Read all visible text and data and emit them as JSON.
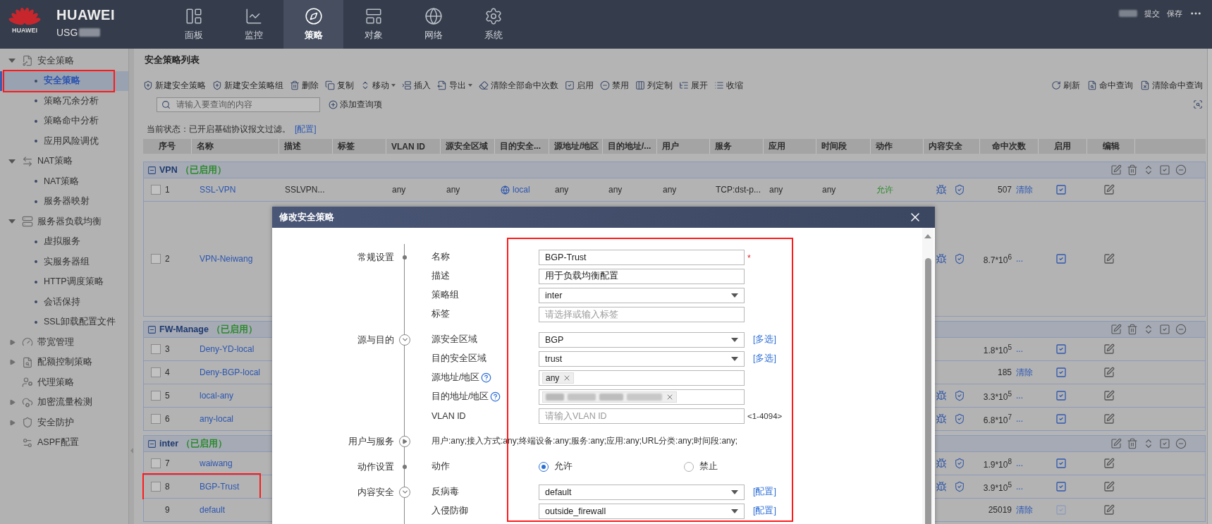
{
  "header": {
    "logo_caption": "HUAWEI",
    "brand": "HUAWEI",
    "device": "USG",
    "nav": [
      {
        "label": "面板",
        "selected": false
      },
      {
        "label": "监控",
        "selected": false
      },
      {
        "label": "策略",
        "selected": true
      },
      {
        "label": "对象",
        "selected": false
      },
      {
        "label": "网络",
        "selected": false
      },
      {
        "label": "系统",
        "selected": false
      }
    ],
    "actions": [
      "提交",
      "保存"
    ]
  },
  "sidebar": {
    "items": [
      {
        "label": "安全策略",
        "kind": "group",
        "expanded": true,
        "children": [
          {
            "label": "安全策略",
            "selected": true,
            "highlighted": true
          },
          {
            "label": "策略冗余分析",
            "selected": false,
            "highlighted": false
          },
          {
            "label": "策略命中分析",
            "selected": false,
            "highlighted": false
          },
          {
            "label": "应用风险调优",
            "selected": false,
            "highlighted": false
          }
        ]
      },
      {
        "label": "NAT策略",
        "kind": "group",
        "expanded": true,
        "children": [
          {
            "label": "NAT策略",
            "selected": false,
            "highlighted": false
          },
          {
            "label": "服务器映射",
            "selected": false,
            "highlighted": false
          }
        ]
      },
      {
        "label": "服务器负载均衡",
        "kind": "group",
        "expanded": true,
        "children": [
          {
            "label": "虚拟服务",
            "selected": false,
            "highlighted": false
          },
          {
            "label": "实服务器组",
            "selected": false,
            "highlighted": false
          },
          {
            "label": "HTTP调度策略",
            "selected": false,
            "highlighted": false
          },
          {
            "label": "会话保持",
            "selected": false,
            "highlighted": false
          },
          {
            "label": "SSL卸载配置文件",
            "selected": false,
            "highlighted": false
          }
        ]
      },
      {
        "label": "带宽管理",
        "kind": "group",
        "expanded": false
      },
      {
        "label": "配额控制策略",
        "kind": "group",
        "expanded": false
      },
      {
        "label": "代理策略",
        "kind": "page"
      },
      {
        "label": "加密流量检测",
        "kind": "group",
        "expanded": false
      },
      {
        "label": "安全防护",
        "kind": "group",
        "expanded": false
      },
      {
        "label": "ASPF配置",
        "kind": "page"
      }
    ]
  },
  "page_title": "安全策略列表",
  "toolbar": {
    "left": [
      {
        "label": "新建安全策略",
        "dropdown": false
      },
      {
        "label": "新建安全策略组",
        "dropdown": false
      },
      {
        "label": "删除",
        "dropdown": false
      },
      {
        "label": "复制",
        "dropdown": false
      },
      {
        "label": "移动",
        "dropdown": true
      },
      {
        "label": "插入",
        "dropdown": false
      },
      {
        "label": "导出",
        "dropdown": true
      },
      {
        "label": "清除全部命中次数",
        "dropdown": false
      },
      {
        "label": "启用",
        "dropdown": false
      },
      {
        "label": "禁用",
        "dropdown": false
      },
      {
        "label": "列定制",
        "dropdown": false
      },
      {
        "label": "展开",
        "dropdown": false
      },
      {
        "label": "收缩",
        "dropdown": false
      }
    ],
    "right": [
      {
        "label": "刷新"
      },
      {
        "label": "命中查询"
      },
      {
        "label": "清除命中查询"
      }
    ]
  },
  "search": {
    "placeholder": "请输入要查询的内容",
    "add_label": "添加查询项"
  },
  "status": {
    "text": "当前状态：已开启基础协议报文过滤。",
    "link": "[配置]"
  },
  "table": {
    "columns": [
      "序号",
      "名称",
      "描述",
      "标签",
      "VLAN ID",
      "源安全区域",
      "目的安全...",
      "源地址/地区",
      "目的地址/...",
      "用户",
      "服务",
      "应用",
      "时间段",
      "动作",
      "内容安全",
      "命中次数",
      "启用",
      "编辑"
    ],
    "groups": [
      {
        "name": "VPN",
        "status": "（已启用）",
        "expanded": true,
        "rows": [
          {
            "no": "1",
            "name": "SSL-VPN",
            "selectable": true,
            "highlighted": false,
            "tall": false,
            "description": "SSLVPN...",
            "vlan_id": "any",
            "source_zone": "any",
            "destination_zone": "local",
            "source_address": "any",
            "destination_address": "any",
            "user": "any",
            "service": "TCP:dst-p...",
            "application": "any",
            "schedule": "any",
            "action": "允许",
            "content_security": true,
            "hits": "507",
            "hits_link": "清除",
            "enabled": true,
            "enable_disabled": false
          },
          {
            "no": "2",
            "name": "VPN-Neiwang",
            "selectable": true,
            "highlighted": false,
            "tall": true,
            "content_security": true,
            "hits": "8.7*10$^{6}$",
            "hits_link": "...",
            "enabled": true,
            "enable_disabled": false
          }
        ]
      },
      {
        "name": "FW-Manage",
        "status": "（已启用）",
        "expanded": true,
        "rows": [
          {
            "no": "3",
            "name": "Deny-YD-local",
            "selectable": true,
            "highlighted": false,
            "tall": false,
            "content_security": false,
            "hits": "1.8*10$^{5}$",
            "hits_link": "...",
            "enabled": true,
            "enable_disabled": false
          },
          {
            "no": "4",
            "name": "Deny-BGP-local",
            "selectable": true,
            "highlighted": false,
            "tall": false,
            "content_security": false,
            "hits": "185",
            "hits_link": "清除",
            "enabled": true,
            "enable_disabled": false
          },
          {
            "no": "5",
            "name": "local-any",
            "selectable": true,
            "highlighted": false,
            "tall": false,
            "content_security": true,
            "hits": "3.3*10$^{5}$",
            "hits_link": "...",
            "enabled": true,
            "enable_disabled": false
          },
          {
            "no": "6",
            "name": "any-local",
            "selectable": true,
            "highlighted": false,
            "tall": false,
            "content_security": true,
            "hits": "6.8*10$^{7}$",
            "hits_link": "...",
            "enabled": true,
            "enable_disabled": false
          }
        ]
      },
      {
        "name": "inter",
        "status": "（已启用）",
        "expanded": true,
        "rows": [
          {
            "no": "7",
            "name": "waiwang",
            "selectable": true,
            "highlighted": false,
            "tall": false,
            "content_security": true,
            "hits": "1.9*10$^{8}$",
            "hits_link": "...",
            "enabled": true,
            "enable_disabled": false
          },
          {
            "no": "8",
            "name": "BGP-Trust",
            "selectable": true,
            "highlighted": true,
            "tall": false,
            "content_security": true,
            "hits": "3.9*10$^{5}$",
            "hits_link": "...",
            "enabled": true,
            "enable_disabled": false
          },
          {
            "no": "9",
            "name": "default",
            "selectable": false,
            "highlighted": false,
            "tall": false,
            "content_security": false,
            "hits": "25019",
            "hits_link": "清除",
            "enabled": true,
            "enable_disabled": true
          }
        ]
      }
    ]
  },
  "dialog": {
    "title": "修改安全策略",
    "highlighted": true,
    "sections": [
      {
        "label": "常规设置",
        "kind": "dot",
        "fields": [
          {
            "label": "名称",
            "kind": "text",
            "value": "BGP-Trust",
            "required_mark": "*"
          },
          {
            "label": "描述",
            "kind": "text",
            "value": "用于负载均衡配置"
          },
          {
            "label": "策略组",
            "kind": "select",
            "value": "inter"
          },
          {
            "label": "标签",
            "kind": "text",
            "placeholder": "请选择或输入标签"
          }
        ]
      },
      {
        "label": "源与目的",
        "kind": "toggle",
        "expanded": true,
        "fields": [
          {
            "label": "源安全区域",
            "kind": "select",
            "value": "BGP",
            "link": "[多选]"
          },
          {
            "label": "目的安全区域",
            "kind": "select",
            "value": "trust",
            "link": "[多选]"
          },
          {
            "label": "源地址/地区",
            "kind": "tags",
            "help": true,
            "tags": [
              {
                "kind": "label",
                "label": "any"
              }
            ]
          },
          {
            "label": "目的地址/地区",
            "kind": "tags",
            "help": true,
            "tags": [
              {
                "kind": "redacted"
              }
            ]
          },
          {
            "label": "VLAN ID",
            "kind": "text",
            "placeholder": "请输入VLAN ID",
            "hint": "<1-4094>"
          }
        ]
      },
      {
        "label": "用户与服务",
        "kind": "toggle",
        "expanded": false,
        "fields": [
          {
            "kind": "summary",
            "text": "用户:any;接入方式:any;终端设备:any;服务:any;应用:any;URL分类:any;时间段:any;"
          }
        ]
      },
      {
        "label": "动作设置",
        "kind": "dot",
        "fields": [
          {
            "label": "动作",
            "kind": "radio",
            "options": [
              {
                "label": "允许",
                "selected": true
              },
              {
                "label": "禁止",
                "selected": false
              }
            ]
          }
        ]
      },
      {
        "label": "内容安全",
        "kind": "toggle",
        "expanded": true,
        "fields": [
          {
            "label": "反病毒",
            "kind": "select",
            "value": "default",
            "link": "[配置]"
          },
          {
            "label": "入侵防御",
            "kind": "select",
            "value": "outside_firewall",
            "link": "[配置]"
          }
        ]
      }
    ]
  }
}
